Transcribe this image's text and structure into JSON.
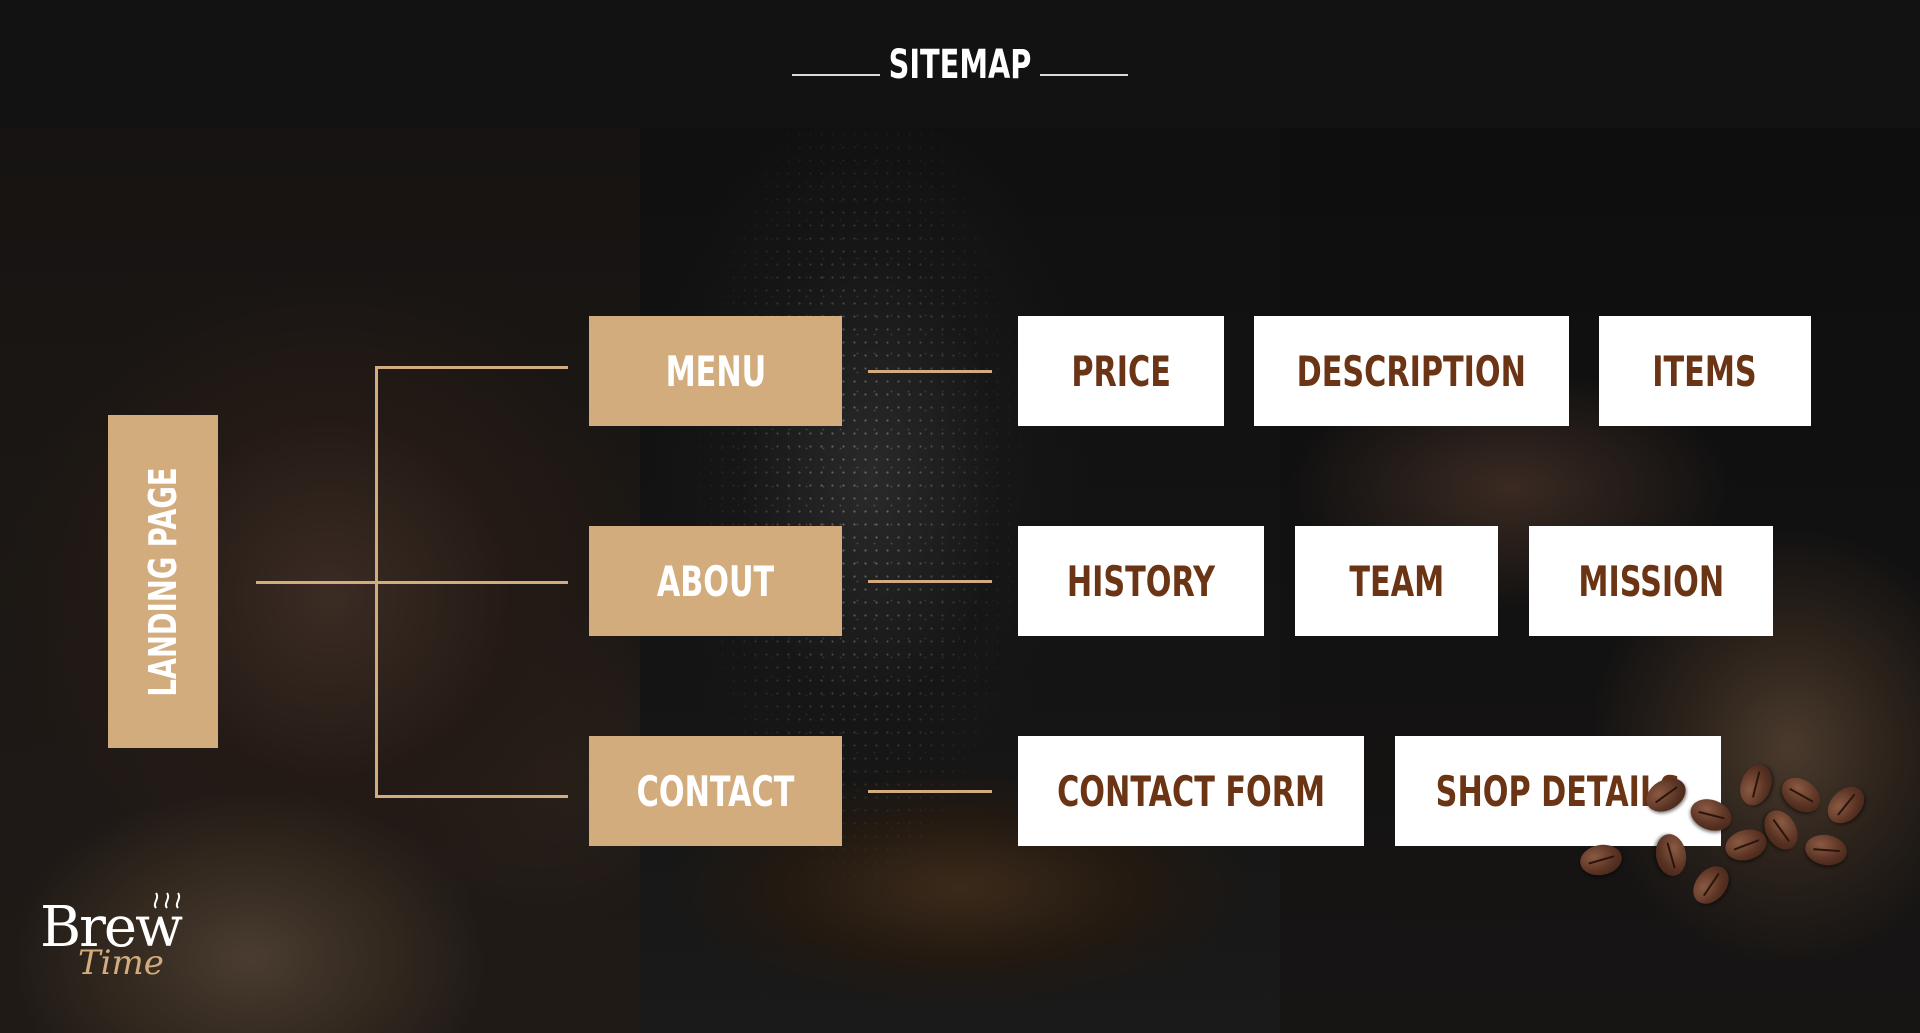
{
  "header": {
    "title": "SITEMAP"
  },
  "root": {
    "label": "LANDING PAGE"
  },
  "sections": [
    {
      "label": "MENU",
      "children": [
        "PRICE",
        "DESCRIPTION",
        "ITEMS"
      ]
    },
    {
      "label": "ABOUT",
      "children": [
        "HISTORY",
        "TEAM",
        "MISSION"
      ]
    },
    {
      "label": "CONTACT",
      "children": [
        "CONTACT FORM",
        "SHOP DETAILS"
      ]
    }
  ],
  "logo": {
    "word": "Brew",
    "script": "Time"
  },
  "colors": {
    "accent": "#d3ac7e",
    "child_text": "#6b3414",
    "header_bg": "#121212",
    "line": "#d2ab7e"
  },
  "icons": [
    "coffee-bean-icon",
    "steam-icon"
  ]
}
